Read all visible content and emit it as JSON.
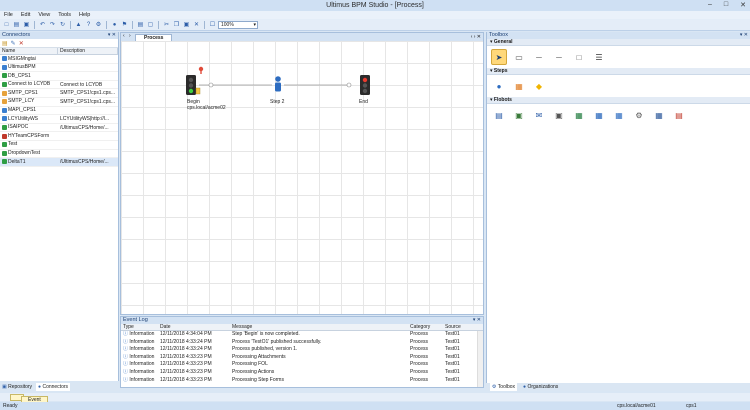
{
  "window": {
    "title": "Ultimus BPM Studio - [Process]"
  },
  "menu": [
    "File",
    "Edit",
    "View",
    "Tools",
    "Help"
  ],
  "toolbar": {
    "zoom": "100%"
  },
  "left_panel": {
    "title": "Connectors",
    "columns": [
      "Name",
      "Description"
    ],
    "rows": [
      {
        "name": "MSIGMngtai",
        "desc": ""
      },
      {
        "name": "UltimusBPM",
        "desc": ""
      },
      {
        "name": "DB_CPS1",
        "desc": ""
      },
      {
        "name": "Connect to LCYDB",
        "desc": "Connect to LCYDB"
      },
      {
        "name": "SMTP_CPS1",
        "desc": "SMTP_CPS1!cps1.cps..."
      },
      {
        "name": "SMTP_LCY",
        "desc": "SMTP_CPS1!cps1.cps..."
      },
      {
        "name": "MAPI_CPS1",
        "desc": ""
      },
      {
        "name": "LCYUtilityWS",
        "desc": "LCYUtilityWS|http://l..."
      },
      {
        "name": "ISAIPOC",
        "desc": "/UltimusCPS/Home/..."
      },
      {
        "name": "HYTeamCPSForm",
        "desc": ""
      },
      {
        "name": "Test",
        "desc": ""
      },
      {
        "name": "DropdownTest",
        "desc": ""
      },
      {
        "name": "DeltaT1",
        "desc": "/UltimusCPS/Home/..."
      }
    ],
    "tabs": [
      "Repository",
      "Connectors"
    ]
  },
  "document": {
    "tab": "Process",
    "nodes": [
      {
        "label": "Begin",
        "sublabel": "cps.local/acme02"
      },
      {
        "label": "Step 2",
        "sublabel": ""
      },
      {
        "label": "End",
        "sublabel": ""
      }
    ]
  },
  "event_log": {
    "title": "Event Log",
    "columns": [
      "Type",
      "Date",
      "Message",
      "Category",
      "Source"
    ],
    "rows": [
      {
        "type": "Information",
        "date": "12/11/2018 4:34:04 PM",
        "message": "Step 'Begin' is now completed.",
        "category": "Process",
        "source": "Test01"
      },
      {
        "type": "Information",
        "date": "12/11/2018 4:33:24 PM",
        "message": "Process 'TestO1' published successfully.",
        "category": "Process",
        "source": "Test01"
      },
      {
        "type": "Information",
        "date": "12/11/2018 4:33:24 PM",
        "message": "Process published, version 1.",
        "category": "Process",
        "source": "Test01"
      },
      {
        "type": "Information",
        "date": "12/11/2018 4:33:23 PM",
        "message": "Processing Attachments",
        "category": "Process",
        "source": "Test01"
      },
      {
        "type": "Information",
        "date": "12/11/2018 4:33:23 PM",
        "message": "Processing FOL",
        "category": "Process",
        "source": "Test01"
      },
      {
        "type": "Information",
        "date": "12/11/2018 4:33:23 PM",
        "message": "Processing Actions",
        "category": "Process",
        "source": "Test01"
      },
      {
        "type": "Information",
        "date": "12/11/2018 4:33:23 PM",
        "message": "Processing Step Forms",
        "category": "Process",
        "source": "Test01"
      }
    ],
    "tab": "Event Log"
  },
  "toolbox": {
    "title": "Toolbox",
    "sections": [
      "General",
      "Steps",
      "Flobots"
    ],
    "tabs": [
      "Toolbox",
      "Organizations"
    ]
  },
  "status": {
    "left": "Ready",
    "server": "cps.local/acme01",
    "user": "cps1"
  }
}
